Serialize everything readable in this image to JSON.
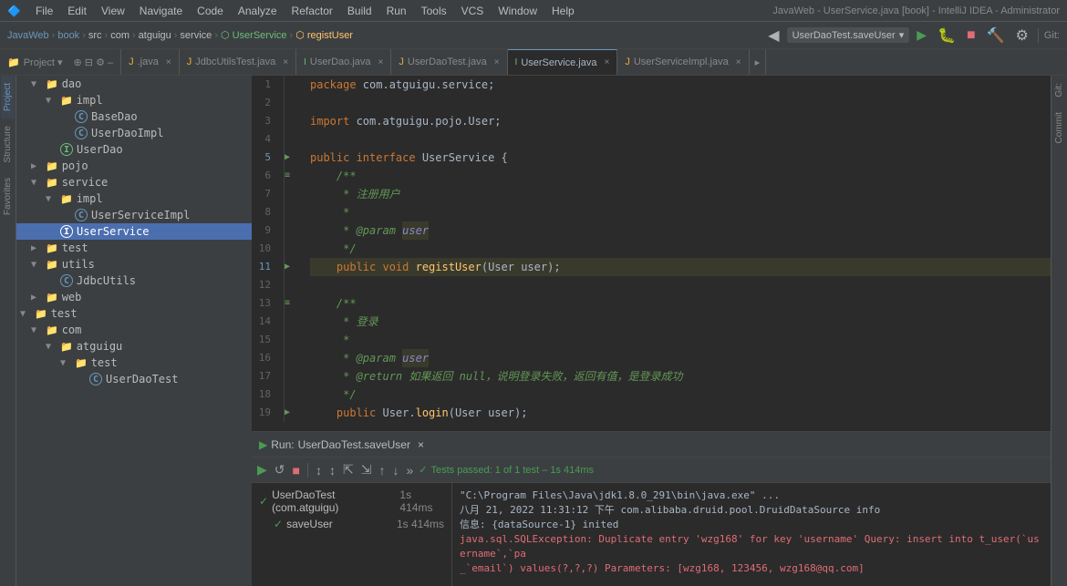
{
  "window": {
    "title": "JavaWeb - UserService.java [book] - IntelliJ IDEA - Administrator"
  },
  "menu": {
    "items": [
      "File",
      "Edit",
      "View",
      "Navigate",
      "Code",
      "Analyze",
      "Refactor",
      "Build",
      "Run",
      "Tools",
      "VCS",
      "Window",
      "Help"
    ]
  },
  "breadcrumb": {
    "items": [
      "JavaWeb",
      "book",
      "src",
      "com",
      "atguigu",
      "service",
      "UserService",
      "registUser"
    ]
  },
  "run_dropdown": {
    "label": "UserDaoTest.saveUser"
  },
  "tabs": [
    {
      "label": ".java",
      "type": "java",
      "active": false
    },
    {
      "label": "JdbcUtilsTest.java",
      "type": "java",
      "active": false
    },
    {
      "label": "UserDao.java",
      "type": "interface",
      "active": false
    },
    {
      "label": "UserDaoTest.java",
      "type": "java",
      "active": false
    },
    {
      "label": "UserService.java",
      "type": "interface",
      "active": true
    },
    {
      "label": "UserServiceImpl.java",
      "type": "java",
      "active": false
    }
  ],
  "project_panel": {
    "title": "Project",
    "tree": [
      {
        "level": 1,
        "type": "folder",
        "label": "dao",
        "expanded": true
      },
      {
        "level": 2,
        "type": "folder",
        "label": "impl",
        "expanded": true
      },
      {
        "level": 3,
        "type": "class",
        "label": "BaseDao"
      },
      {
        "level": 3,
        "type": "class",
        "label": "UserDaoImpl"
      },
      {
        "level": 2,
        "type": "interface",
        "label": "UserDao"
      },
      {
        "level": 1,
        "type": "folder",
        "label": "pojo",
        "expanded": false
      },
      {
        "level": 1,
        "type": "folder",
        "label": "service",
        "expanded": true
      },
      {
        "level": 2,
        "type": "folder",
        "label": "impl",
        "expanded": true
      },
      {
        "level": 3,
        "type": "class",
        "label": "UserServiceImpl"
      },
      {
        "level": 2,
        "type": "interface",
        "label": "UserService",
        "selected": true
      },
      {
        "level": 1,
        "type": "folder",
        "label": "test",
        "expanded": false
      },
      {
        "level": 1,
        "type": "folder",
        "label": "utils",
        "expanded": true
      },
      {
        "level": 2,
        "type": "class",
        "label": "JdbcUtils"
      },
      {
        "level": 1,
        "type": "folder",
        "label": "web",
        "expanded": false
      },
      {
        "level": 0,
        "type": "folder",
        "label": "test",
        "expanded": true
      },
      {
        "level": 1,
        "type": "folder",
        "label": "com",
        "expanded": true
      },
      {
        "level": 2,
        "type": "folder",
        "label": "atguigu",
        "expanded": true
      },
      {
        "level": 3,
        "type": "folder",
        "label": "test",
        "expanded": true
      },
      {
        "level": 4,
        "type": "class",
        "label": "UserDaoTest"
      }
    ]
  },
  "editor": {
    "lines": [
      {
        "num": 1,
        "tokens": [
          {
            "t": "kw",
            "v": "package "
          },
          {
            "t": "cn",
            "v": "com.atguigu.service;"
          }
        ]
      },
      {
        "num": 2,
        "tokens": []
      },
      {
        "num": 3,
        "tokens": [
          {
            "t": "kw",
            "v": "import "
          },
          {
            "t": "cn",
            "v": "com.atguigu.pojo.User;"
          }
        ]
      },
      {
        "num": 4,
        "tokens": []
      },
      {
        "num": 5,
        "tokens": [
          {
            "t": "kw",
            "v": "public interface "
          },
          {
            "t": "cn",
            "v": "UserService {"
          }
        ],
        "gutter": "▶"
      },
      {
        "num": 6,
        "tokens": [
          {
            "t": "cm",
            "v": "    /**"
          }
        ],
        "gutter": "≡"
      },
      {
        "num": 7,
        "tokens": [
          {
            "t": "cm",
            "v": "     * 注册用户"
          }
        ]
      },
      {
        "num": 8,
        "tokens": [
          {
            "t": "cm",
            "v": "     *"
          }
        ]
      },
      {
        "num": 9,
        "tokens": [
          {
            "t": "cm",
            "v": "     * "
          },
          {
            "t": "param-tag",
            "v": "@param"
          },
          {
            "t": "cm",
            "v": " "
          },
          {
            "t": "param-name",
            "v": "user"
          }
        ]
      },
      {
        "num": 10,
        "tokens": [
          {
            "t": "cm",
            "v": "     */"
          }
        ]
      },
      {
        "num": 11,
        "tokens": [
          {
            "t": "kw",
            "v": "    public void "
          },
          {
            "t": "method",
            "v": "registUser"
          },
          {
            "t": "cn",
            "v": "(User user);"
          }
        ],
        "gutter": "▶"
      },
      {
        "num": 12,
        "tokens": []
      },
      {
        "num": 13,
        "tokens": [
          {
            "t": "cm",
            "v": "    /**"
          }
        ],
        "gutter": "≡"
      },
      {
        "num": 14,
        "tokens": [
          {
            "t": "cm",
            "v": "     * 登录"
          }
        ]
      },
      {
        "num": 15,
        "tokens": [
          {
            "t": "cm",
            "v": "     *"
          }
        ]
      },
      {
        "num": 16,
        "tokens": [
          {
            "t": "cm",
            "v": "     * "
          },
          {
            "t": "param-tag",
            "v": "@param"
          },
          {
            "t": "cm",
            "v": " "
          },
          {
            "t": "param-name",
            "v": "user"
          }
        ]
      },
      {
        "num": 17,
        "tokens": [
          {
            "t": "cm",
            "v": "     * "
          },
          {
            "t": "ret",
            "v": "@return"
          },
          {
            "t": "cm",
            "v": " 如果返回 null，说明登录失败，返回有值，是登录成功"
          }
        ]
      },
      {
        "num": 18,
        "tokens": [
          {
            "t": "cm",
            "v": "     */"
          }
        ]
      },
      {
        "num": 19,
        "tokens": [
          {
            "t": "kw",
            "v": "    public User.login(User user);"
          }
        ]
      }
    ]
  },
  "run_panel": {
    "tab_label": "Run:",
    "run_name": "UserDaoTest.saveUser",
    "pass_text": "Tests passed: 1 of 1 test – 1s 414ms",
    "test_items": [
      {
        "label": "UserDaoTest (com.atguigu)",
        "time": "1s 414ms",
        "pass": true
      },
      {
        "label": "saveUser",
        "time": "1s 414ms",
        "pass": true
      }
    ],
    "console": [
      {
        "text": "\"C:\\Program Files\\Java\\jdk1.8.0_291\\bin\\java.exe\" ...",
        "type": "info"
      },
      {
        "text": "八月 21, 2022 11:31:12 下午 com.alibaba.druid.pool.DruidDataSource info",
        "type": "info"
      },
      {
        "text": "信息: {dataSource-1} inited",
        "type": "info"
      },
      {
        "text": "java.sql.SQLException: Duplicate entry 'wzg168' for key 'username' Query: insert into t_user(`username`,`pa",
        "type": "error"
      },
      {
        "text": "_`email`) values(?,?,?) Parameters: [wzg168, 123456, wzg168@qq.com]",
        "type": "error"
      }
    ]
  },
  "left_tabs": [
    "Project",
    "Structure",
    "Favorites"
  ],
  "right_tabs": [
    "Git:",
    "Commit"
  ]
}
